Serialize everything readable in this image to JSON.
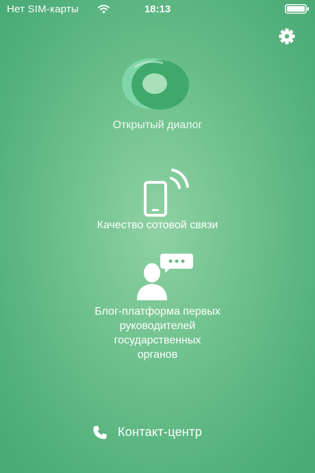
{
  "status_bar": {
    "carrier": "Нет SIM-карты",
    "time": "18:13",
    "wifi_icon": "wifi-icon",
    "battery_icon": "battery-icon",
    "battery_level": 1.0
  },
  "header": {
    "settings_icon": "gear-icon"
  },
  "menu": {
    "items": [
      {
        "label": "Открытый диалог",
        "icon": "open-dialog-logo"
      },
      {
        "label": "Качество сотовой связи",
        "icon": "phone-signal-icon"
      },
      {
        "label": "Блог-платформа первых\nруководителей\nгосударственных\nорганов",
        "icon": "user-chat-icon"
      }
    ]
  },
  "footer": {
    "contact_label": "Контакт-центр",
    "contact_icon": "phone-icon"
  },
  "colors": {
    "background_center": "#8fd1a4",
    "background_edge": "#48a973",
    "logo_dark": "#3fa96c",
    "logo_light": "#7fd6a8",
    "text": "#ffffff"
  }
}
